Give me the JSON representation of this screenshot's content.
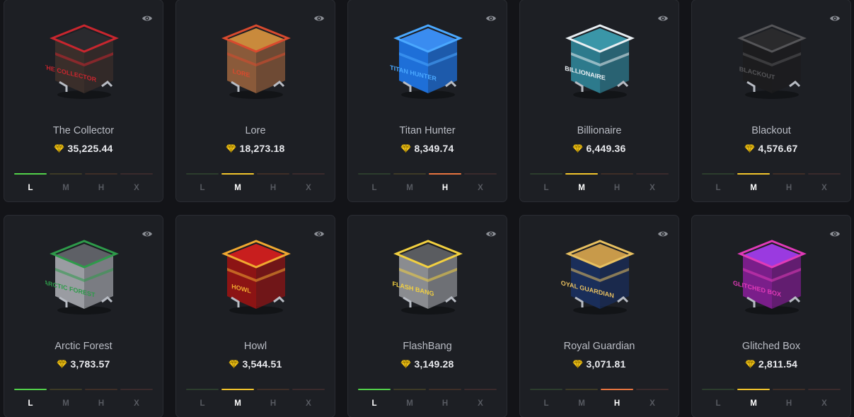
{
  "theme": {
    "background": "#131418",
    "card": "#1d1f24",
    "gem_color": "#f5c518"
  },
  "tier_labels": [
    "L",
    "M",
    "H",
    "X"
  ],
  "cases": [
    {
      "name": "The Collector",
      "price": "35,225.44",
      "active_tier": "L",
      "body_color": "#3a2e2a",
      "accent_color": "#c8262e",
      "lid_color": "#2a2a2e",
      "art_text": "THE COLLECTOR"
    },
    {
      "name": "Lore",
      "price": "18,273.18",
      "active_tier": "M",
      "body_color": "#8a5a3a",
      "accent_color": "#d84a2e",
      "lid_color": "#c98a3c",
      "art_text": "LORE"
    },
    {
      "name": "Titan Hunter",
      "price": "8,349.74",
      "active_tier": "H",
      "body_color": "#1e6fd8",
      "accent_color": "#4aa8ff",
      "lid_color": "#3a8cf0",
      "art_text": "TITAN HUNTER"
    },
    {
      "name": "Billionaire",
      "price": "6,449.36",
      "active_tier": "M",
      "body_color": "#2d7a8c",
      "accent_color": "#e8eef2",
      "lid_color": "#3a96a8",
      "art_text": "BILLIONAIRE"
    },
    {
      "name": "Blackout",
      "price": "4,576.67",
      "active_tier": "M",
      "body_color": "#1c1c1e",
      "accent_color": "#555558",
      "lid_color": "#2a2a2c",
      "art_text": "BLACKOUT"
    },
    {
      "name": "Arctic Forest",
      "price": "3,783.57",
      "active_tier": "L",
      "body_color": "#9a9ca2",
      "accent_color": "#2e9a4a",
      "lid_color": "#5e6066",
      "art_text": "ARCTIC FOREST"
    },
    {
      "name": "Howl",
      "price": "3,544.51",
      "active_tier": "M",
      "body_color": "#8c1414",
      "accent_color": "#f0a830",
      "lid_color": "#c81e1e",
      "art_text": "HOWL"
    },
    {
      "name": "FlashBang",
      "price": "3,149.28",
      "active_tier": "L",
      "body_color": "#8a8c90",
      "accent_color": "#f2d040",
      "lid_color": "#5a5c60",
      "art_text": "FLASH BANG"
    },
    {
      "name": "Royal Guardian",
      "price": "3,071.81",
      "active_tier": "H",
      "body_color": "#1a2e5a",
      "accent_color": "#e8c060",
      "lid_color": "#c89a4a",
      "art_text": "ROYAL GUARDIAN"
    },
    {
      "name": "Glitched Box",
      "price": "2,811.54",
      "active_tier": "M",
      "body_color": "#7a1e8a",
      "accent_color": "#e03ab8",
      "lid_color": "#9a3ae0",
      "art_text": "GLITCHED BOX"
    }
  ]
}
